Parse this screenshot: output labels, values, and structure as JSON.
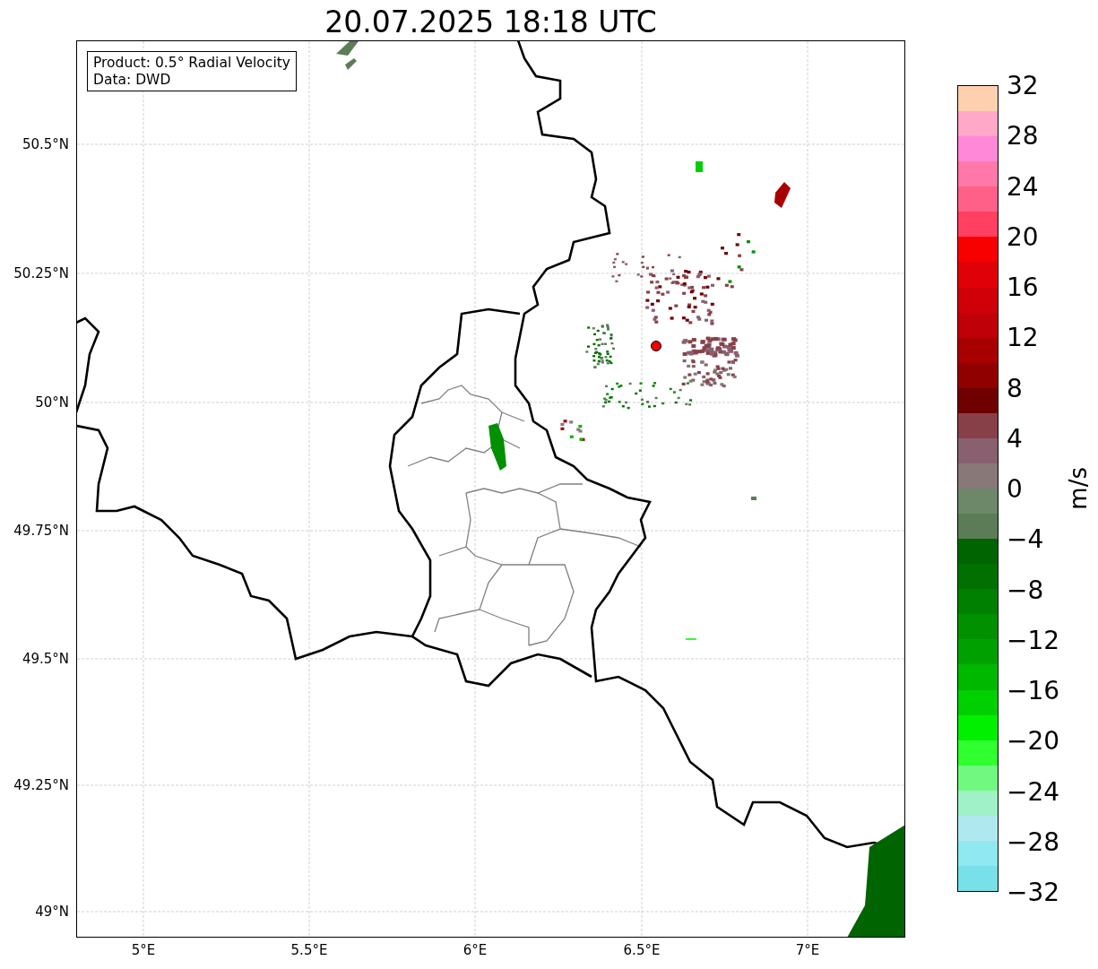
{
  "title": "20.07.2025 18:18 UTC",
  "info_box": {
    "lines": [
      "Product: 0.5° Radial Velocity",
      "Data: DWD"
    ]
  },
  "map": {
    "lat_ticks": [
      "50.5°N",
      "50.25°N",
      "50°N",
      "49.75°N",
      "49.5°N",
      "49.25°N",
      "49°N"
    ],
    "lon_ticks": [
      "5°E",
      "5.5°E",
      "6°E",
      "6.5°E",
      "7°E"
    ]
  },
  "colorbar": {
    "label": "m/s",
    "ticks": [
      "32",
      "28",
      "24",
      "20",
      "16",
      "12",
      "8",
      "4",
      "0",
      "−4",
      "−8",
      "−12",
      "−16",
      "−20",
      "−24",
      "−28",
      "−32"
    ],
    "bands": [
      {
        "color": "#ffd0b0"
      },
      {
        "color": "#ffa8c8"
      },
      {
        "color": "#ff88d8"
      },
      {
        "color": "#ff78a8"
      },
      {
        "color": "#ff6088"
      },
      {
        "color": "#ff4060"
      },
      {
        "color": "#f80000"
      },
      {
        "color": "#e00008"
      },
      {
        "color": "#d00008"
      },
      {
        "color": "#c00008"
      },
      {
        "color": "#a80000"
      },
      {
        "color": "#900000"
      },
      {
        "color": "#700000"
      },
      {
        "color": "#884048"
      },
      {
        "color": "#886070"
      },
      {
        "color": "#887878"
      },
      {
        "color": "#6c8868"
      },
      {
        "color": "#5c7c58"
      },
      {
        "color": "#006400"
      },
      {
        "color": "#007000"
      },
      {
        "color": "#008000"
      },
      {
        "color": "#009000"
      },
      {
        "color": "#00a000"
      },
      {
        "color": "#00b800"
      },
      {
        "color": "#00d000"
      },
      {
        "color": "#00f000"
      },
      {
        "color": "#30ff30"
      },
      {
        "color": "#70f880"
      },
      {
        "color": "#a0f0c8"
      },
      {
        "color": "#b0e8f0"
      },
      {
        "color": "#90e8f0"
      },
      {
        "color": "#78e0e8"
      }
    ]
  }
}
